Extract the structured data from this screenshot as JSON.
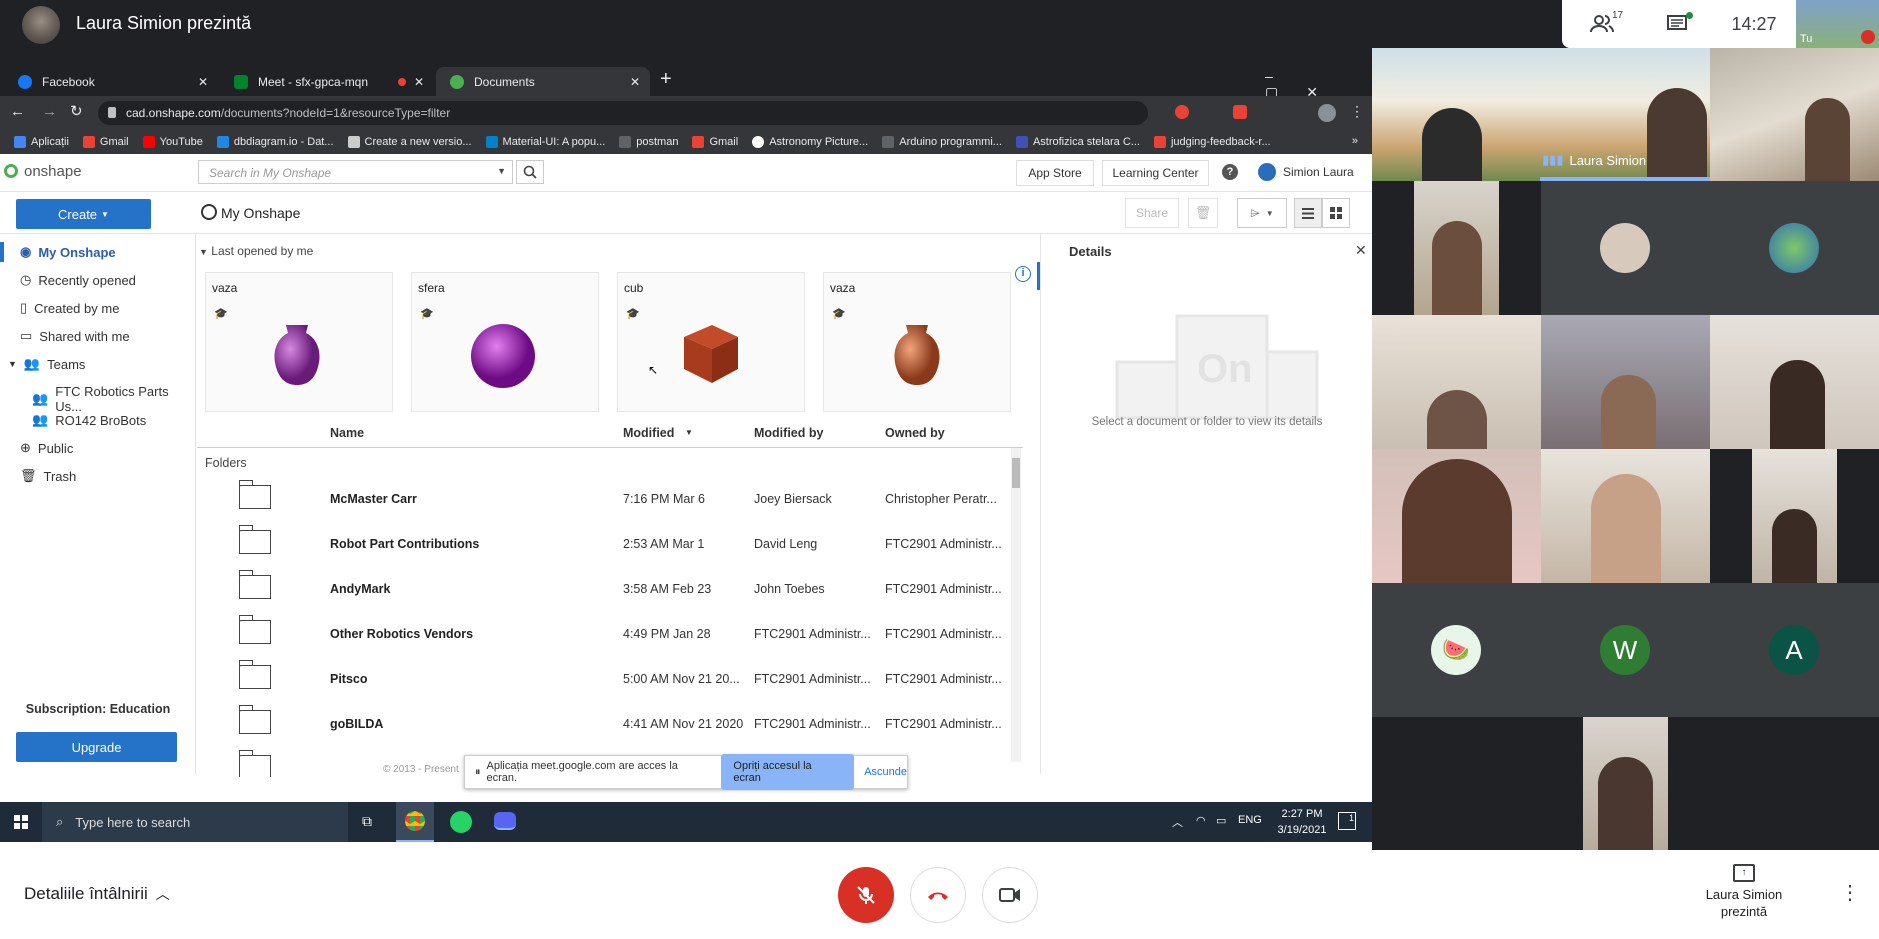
{
  "meet": {
    "presenter_title": "Laura Simion prezintă",
    "participants_count": "17",
    "time": "14:27",
    "self_label": "Tu",
    "active_speaker": "Laura Simion",
    "details_label": "Detaliile întâlnirii",
    "present_label": "Laura Simion prezintă",
    "tiles": [
      {
        "initial": "W",
        "color": "#2e7d32"
      },
      {
        "initial": "A",
        "color": "#0b5345"
      }
    ]
  },
  "browser": {
    "tabs": [
      "Facebook",
      "Meet - sfx-gpca-mqn",
      "Documents"
    ],
    "url_host": "cad.onshape.com",
    "url_path": "/documents?nodeId=1&resourceType=filter",
    "bookmarks": [
      "Aplicații",
      "Gmail",
      "YouTube",
      "dbdiagram.io - Dat...",
      "Create a new versio...",
      "Material-UI: A popu...",
      "postman",
      "Gmail",
      "Astronomy Picture...",
      "Arduino programmi...",
      "Astrofizica stelara C...",
      "judging-feedback-r..."
    ],
    "more": "»"
  },
  "onshape": {
    "logo": "onshape",
    "search_placeholder": "Search in My Onshape",
    "app_store": "App Store",
    "learning_center": "Learning Center",
    "help": "?",
    "user": "Simion Laura",
    "create": "Create",
    "heading": "My Onshape",
    "share": "Share",
    "nav": [
      "My Onshape",
      "Recently opened",
      "Created by me",
      "Shared with me",
      "Teams",
      "FTC Robotics Parts Us...",
      "RO142 BroBots",
      "Public",
      "Trash"
    ],
    "subscription": "Subscription: Education",
    "upgrade": "Upgrade",
    "recent_header": "Last opened by me",
    "recent": [
      "vaza",
      "sfera",
      "cub",
      "vaza"
    ],
    "columns": {
      "name": "Name",
      "modified": "Modified",
      "modified_by": "Modified by",
      "owned_by": "Owned by"
    },
    "folders_label": "Folders",
    "rows": [
      {
        "name": "McMaster Carr",
        "modified": "7:16 PM Mar 6",
        "modified_by": "Joey Biersack",
        "owned_by": "Christopher Peratr..."
      },
      {
        "name": "Robot Part Contributions",
        "modified": "2:53 AM Mar 1",
        "modified_by": "David Leng",
        "owned_by": "FTC2901 Administr..."
      },
      {
        "name": "AndyMark",
        "modified": "3:58 AM Feb 23",
        "modified_by": "John Toebes",
        "owned_by": "FTC2901 Administr..."
      },
      {
        "name": "Other Robotics Vendors",
        "modified": "4:49 PM Jan 28",
        "modified_by": "FTC2901 Administr...",
        "owned_by": "FTC2901 Administr..."
      },
      {
        "name": "Pitsco",
        "modified": "5:00 AM Nov 21 20...",
        "modified_by": "FTC2901 Administr...",
        "owned_by": "FTC2901 Administr..."
      },
      {
        "name": "goBILDA",
        "modified": "4:41 AM Nov 21 2020",
        "modified_by": "FTC2901 Administr...",
        "owned_by": "FTC2901 Administr..."
      }
    ],
    "details_title": "Details",
    "details_empty": "Select a document or folder to view its details",
    "footer": "© 2013 - Present"
  },
  "share_banner": {
    "text": "Aplicația meet.google.com are acces la ecran.",
    "stop": "Opriți accesul la ecran",
    "hide": "Ascunde"
  },
  "taskbar": {
    "search": "Type here to search",
    "lang": "ENG",
    "time": "2:27 PM",
    "date": "3/19/2021",
    "notif": "1"
  }
}
